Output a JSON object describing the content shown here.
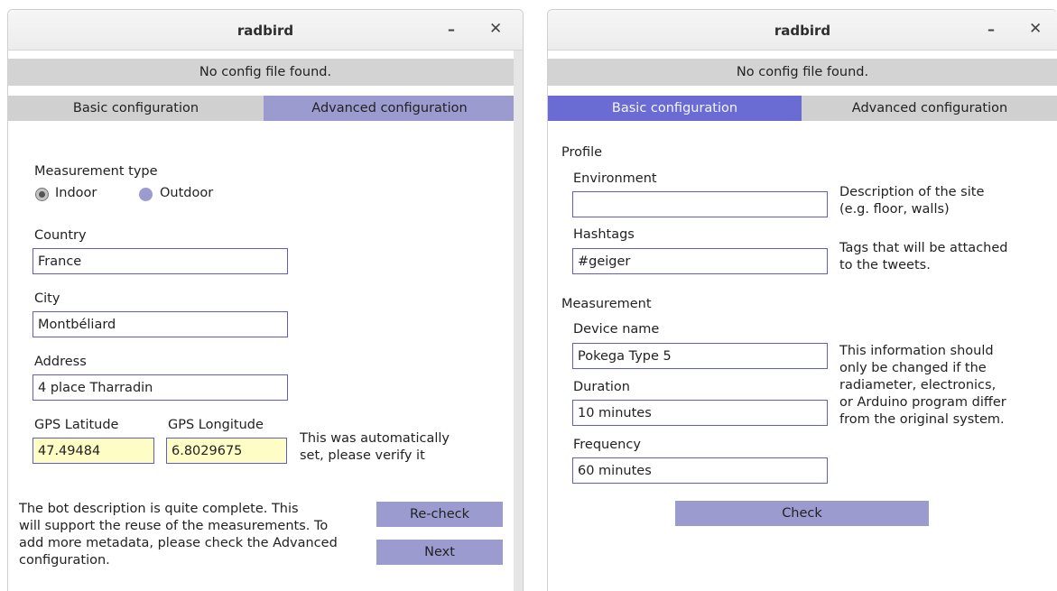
{
  "left_window": {
    "title": "radbird",
    "minimize_label": "–",
    "close_label": "✕",
    "status": "No config file found.",
    "tabs": [
      "Basic configuration",
      "Advanced configuration"
    ],
    "measurement_type": {
      "label": "Measurement type",
      "options": [
        "Indoor",
        "Outdoor"
      ],
      "selected": "Indoor"
    },
    "country": {
      "label": "Country",
      "value": "France"
    },
    "city": {
      "label": "City",
      "value": "Montbéliard"
    },
    "address": {
      "label": "Address",
      "value": "4 place Tharradin"
    },
    "gps_latitude": {
      "label": "GPS Latitude",
      "value": "47.49484"
    },
    "gps_longitude": {
      "label": "GPS Longitude",
      "value": "6.8029675"
    },
    "gps_note": [
      "This was automatically",
      "set, please verify it"
    ],
    "description": [
      "The bot description is quite complete. This",
      "will support the reuse of the measurements. To",
      "add more metadata, please check the Advanced",
      "configuration."
    ],
    "recheck_label": "Re-check",
    "next_label": "Next"
  },
  "right_window": {
    "title": "radbird",
    "minimize_label": "–",
    "close_label": "✕",
    "status": "No config file found.",
    "tabs": [
      "Basic configuration",
      "Advanced configuration"
    ],
    "profile_heading": "Profile",
    "environment": {
      "label": "Environment",
      "value": ""
    },
    "environment_help": [
      "Description of the site",
      "(e.g. floor, walls)"
    ],
    "hashtags": {
      "label": "Hashtags",
      "value": "#geiger"
    },
    "hashtags_help": [
      "Tags that will be attached",
      "to the tweets."
    ],
    "measurement_heading": "Measurement",
    "device_name": {
      "label": "Device name",
      "value": "Pokega Type 5"
    },
    "duration": {
      "label": "Duration",
      "value": "10 minutes"
    },
    "frequency": {
      "label": "Frequency",
      "value": "60 minutes"
    },
    "measurement_help": [
      "This information should",
      "only be changed if the",
      "radiameter, electronics,",
      "or Arduino program differ",
      "from the original system."
    ],
    "check_label": "Check"
  },
  "colors": {
    "accent": "#9b9bd0",
    "active_tab": "#6b6bd4",
    "field_border": "#5e5ec6",
    "gps_background": "#fefdc6"
  }
}
